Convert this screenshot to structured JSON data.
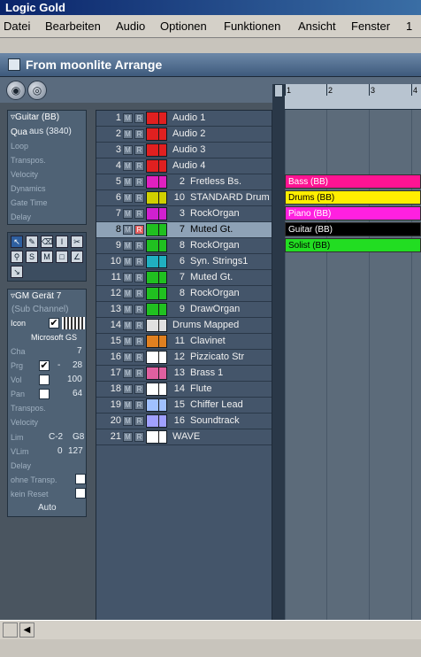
{
  "app": {
    "title": "Logic Gold"
  },
  "menu": {
    "items": [
      "Datei",
      "Bearbeiten",
      "Audio",
      "Optionen",
      "Funktionen",
      "Ansicht",
      "Fenster",
      "1"
    ]
  },
  "window": {
    "title": "From moonlite Arrange"
  },
  "region_panel": {
    "title": "Guitar  (BB)",
    "qua_label": "Qua",
    "qua_value": "aus (3840)",
    "loop": "Loop",
    "transpos": "Transpos.",
    "velocity": "Velocity",
    "dynamics": "Dynamics",
    "gate_time": "Gate Time",
    "delay": "Delay"
  },
  "instrument_panel": {
    "title": "GM Gerät  7",
    "subtitle": "(Sub Channel)",
    "icon_label": "Icon",
    "device": "Microsoft GS",
    "cha_label": "Cha",
    "cha_value": "7",
    "prg_label": "Prg",
    "prg_dash": "-",
    "prg_value": "28",
    "vol_label": "Vol",
    "vol_value": "100",
    "pan_label": "Pan",
    "pan_value": "64",
    "transpos": "Transpos.",
    "velocity": "Velocity",
    "lim_label": "Lim",
    "lim_low": "C-2",
    "lim_high": "G8",
    "vlim_label": "VLim",
    "vlim_low": "0",
    "vlim_high": "127",
    "delay": "Delay",
    "no_transp": "ohne Transp.",
    "no_reset": "kein Reset",
    "auto": "Auto"
  },
  "track_buttons": {
    "m": "M",
    "r": "R"
  },
  "tracks": [
    {
      "num": "1",
      "ch": "",
      "name": "Audio 1",
      "icon": "audio-icon",
      "color": "#e02020"
    },
    {
      "num": "2",
      "ch": "",
      "name": "Audio 2",
      "icon": "audio-icon",
      "color": "#e02020"
    },
    {
      "num": "3",
      "ch": "",
      "name": "Audio 3",
      "icon": "audio-icon",
      "color": "#e02020"
    },
    {
      "num": "4",
      "ch": "",
      "name": "Audio 4",
      "icon": "audio-icon",
      "color": "#e02020"
    },
    {
      "num": "5",
      "ch": "2",
      "name": "Fretless Bs.",
      "icon": "bass-icon",
      "color": "#e020c0"
    },
    {
      "num": "6",
      "ch": "10",
      "name": "STANDARD Drum",
      "icon": "drum-icon",
      "color": "#d0d000"
    },
    {
      "num": "7",
      "ch": "3",
      "name": "RockOrgan",
      "icon": "organ-icon",
      "color": "#d020d0"
    },
    {
      "num": "8",
      "ch": "7",
      "name": "Muted Gt.",
      "icon": "guitar-icon",
      "color": "#20c020",
      "selected": true,
      "record": true
    },
    {
      "num": "9",
      "ch": "8",
      "name": "RockOrgan",
      "icon": "organ-icon",
      "color": "#20c020"
    },
    {
      "num": "10",
      "ch": "6",
      "name": "Syn. Strings1",
      "icon": "strings-icon",
      "color": "#20b0c0"
    },
    {
      "num": "11",
      "ch": "7",
      "name": "Muted Gt.",
      "icon": "guitar-icon",
      "color": "#20c020"
    },
    {
      "num": "12",
      "ch": "8",
      "name": "RockOrgan",
      "icon": "organ-icon",
      "color": "#20c020"
    },
    {
      "num": "13",
      "ch": "9",
      "name": "DrawOrgan",
      "icon": "organ-icon",
      "color": "#20c020"
    },
    {
      "num": "14",
      "ch": "",
      "name": "Drums Mapped",
      "icon": "mapped-drum-icon",
      "color": "#e0e0e0"
    },
    {
      "num": "15",
      "ch": "11",
      "name": "Clavinet",
      "icon": "clavinet-icon",
      "color": "#e08020"
    },
    {
      "num": "16",
      "ch": "12",
      "name": "Pizzicato Str",
      "icon": "violin-icon",
      "color": "#ffffff"
    },
    {
      "num": "17",
      "ch": "13",
      "name": "Brass 1",
      "icon": "brass-icon",
      "color": "#e060a0"
    },
    {
      "num": "18",
      "ch": "14",
      "name": "Flute",
      "icon": "flute-icon",
      "color": "#ffffff"
    },
    {
      "num": "19",
      "ch": "15",
      "name": "Chiffer Lead",
      "icon": "lead-icon",
      "color": "#a0c0ff"
    },
    {
      "num": "20",
      "ch": "16",
      "name": "Soundtrack",
      "icon": "soundtrack-icon",
      "color": "#a0a0ff"
    },
    {
      "num": "21",
      "ch": "",
      "name": "WAVE",
      "icon": "wave-icon",
      "color": "#ffffff"
    }
  ],
  "ruler": {
    "bars": [
      "1",
      "2",
      "3",
      "4"
    ]
  },
  "regions": [
    {
      "name": "Bass  (BB)",
      "track": 5,
      "color": "#ff1493",
      "text": "#ffffff"
    },
    {
      "name": "Drums  (BB)",
      "track": 6,
      "color": "#ffee00",
      "text": "#000000"
    },
    {
      "name": "Piano  (BB)",
      "track": 7,
      "color": "#ff20e0",
      "text": "#ffffff"
    },
    {
      "name": "Guitar  (BB)",
      "track": 8,
      "color": "#000000",
      "text": "#ffffff"
    },
    {
      "name": "Solist (BB)",
      "track": 9,
      "color": "#22dd22",
      "text": "#000000"
    }
  ]
}
